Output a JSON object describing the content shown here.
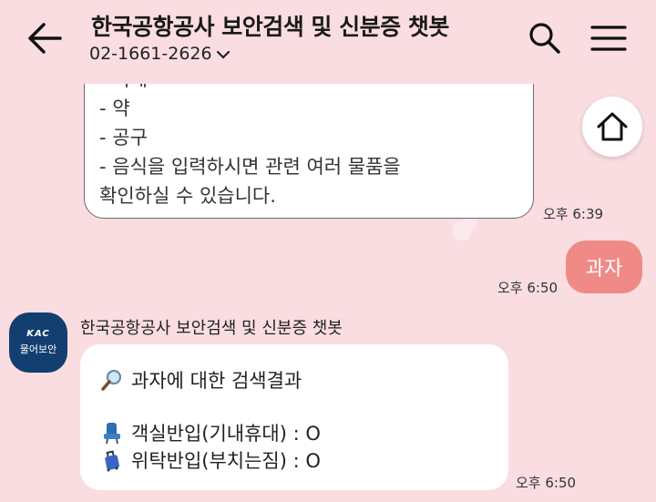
{
  "header": {
    "title": "한국공항공사 보안검색 및 신분증 챗봇",
    "phone": "02-1661-2626"
  },
  "messages": {
    "prev_bot": {
      "clipped_line": "- 기계",
      "lines": [
        "- 약",
        "- 공구",
        "- 음식을 입력하시면 관련 여러 물품을",
        "확인하실 수 있습니다."
      ],
      "time": "오후 6:39"
    },
    "user": {
      "text": "과자",
      "time": "오후 6:50"
    },
    "bot": {
      "sender": "한국공항공사 보안검색 및 신분증 챗봇",
      "avatar_logo": "KAC",
      "avatar_text": "물어보안",
      "search_title": "과자에 대한 검색결과",
      "carry_on": "객실반입(기내휴대) : O",
      "checked": "위탁반입(부치는짐) : O",
      "time": "오후 6:50"
    }
  },
  "icons": {
    "back": "arrow-left-icon",
    "search": "search-icon",
    "menu": "hamburger-menu-icon",
    "home": "home-icon",
    "magnifier": "magnifying-glass-emoji-icon",
    "seat": "seat-emoji-icon",
    "luggage": "luggage-emoji-icon"
  },
  "colors": {
    "background": "#f9dde1",
    "user_bubble": "#f08a86",
    "avatar": "#133e70"
  }
}
